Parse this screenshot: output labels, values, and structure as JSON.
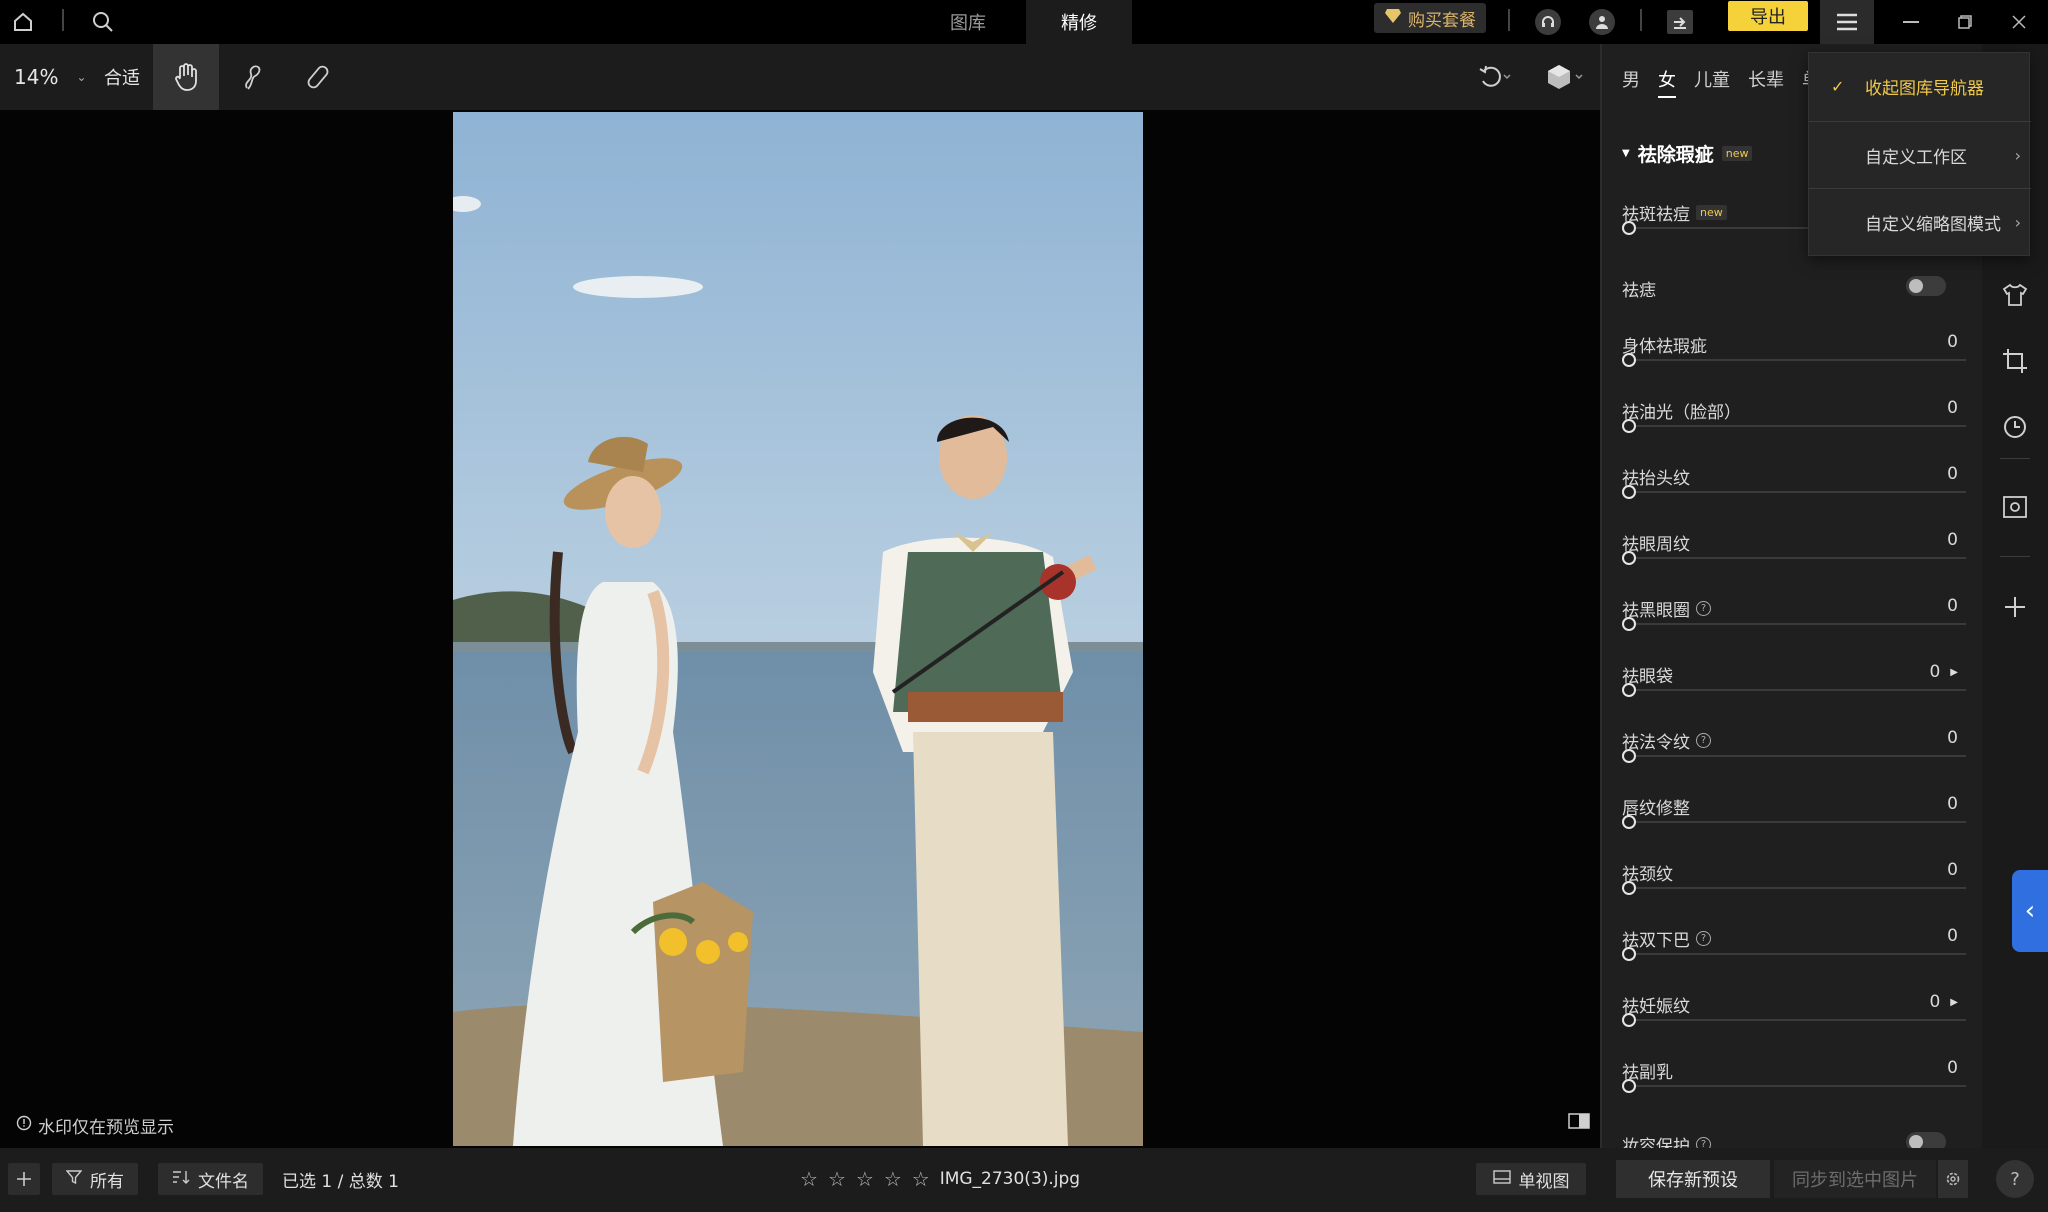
{
  "top_bar": {
    "tabs": [
      {
        "label": "图库",
        "active": false
      },
      {
        "label": "精修",
        "active": true
      }
    ],
    "buy_label": "购买套餐",
    "export_label": "导出"
  },
  "toolbar": {
    "zoom": "14%",
    "fit_label": "合适"
  },
  "canvas": {
    "watermark_note": "水印仅在预览显示"
  },
  "bottom_bar": {
    "filter_label": "所有",
    "sort_label": "文件名",
    "selection": "已选 1 / 总数 1",
    "rating_stars": 0,
    "filename": "IMG_2730(3).jpg",
    "view_label": "单视图",
    "save_preset_label": "保存新预设",
    "sync_label": "同步到选中图片",
    "help_label": "?"
  },
  "panel": {
    "gender_tabs": [
      {
        "label": "男",
        "active": false
      },
      {
        "label": "女",
        "active": true
      },
      {
        "label": "儿童",
        "active": false
      },
      {
        "label": "长辈",
        "active": false
      },
      {
        "label": "单人",
        "active": false
      }
    ],
    "section_title": "祛除瑕疵",
    "new_badge": "new",
    "adjustments": [
      {
        "label": "祛斑祛痘",
        "badge": "new",
        "value": "",
        "type": "slider"
      },
      {
        "label": "祛痣",
        "value": "",
        "type": "toggle"
      },
      {
        "label": "身体祛瑕疵",
        "value": "0",
        "type": "slider"
      },
      {
        "label": "祛油光（脸部）",
        "value": "0",
        "type": "slider"
      },
      {
        "label": "祛抬头纹",
        "value": "0",
        "type": "slider"
      },
      {
        "label": "祛眼周纹",
        "value": "0",
        "type": "slider"
      },
      {
        "label": "祛黑眼圈",
        "value": "0",
        "type": "slider",
        "help": true
      },
      {
        "label": "祛眼袋",
        "value": "0",
        "type": "slider",
        "expand": true
      },
      {
        "label": "祛法令纹",
        "value": "0",
        "type": "slider",
        "help": true
      },
      {
        "label": "唇纹修整",
        "value": "0",
        "type": "slider"
      },
      {
        "label": "祛颈纹",
        "value": "0",
        "type": "slider"
      },
      {
        "label": "祛双下巴",
        "value": "0",
        "type": "slider",
        "help": true
      },
      {
        "label": "祛妊娠纹",
        "value": "0",
        "type": "slider",
        "expand": true
      },
      {
        "label": "祛副乳",
        "value": "0",
        "type": "slider"
      },
      {
        "label": "妆容保护",
        "value": "",
        "type": "toggle",
        "help": true
      }
    ]
  },
  "dropdown": {
    "items": [
      {
        "label": "收起图库导航器",
        "checked": true
      },
      {
        "label": "自定义工作区",
        "submenu": true
      },
      {
        "label": "自定义缩略图模式",
        "submenu": true
      }
    ]
  },
  "colors": {
    "accent_yellow": "#f5d23a",
    "accent_blue": "#2f6fe0",
    "checked_text": "#f0c94a"
  }
}
